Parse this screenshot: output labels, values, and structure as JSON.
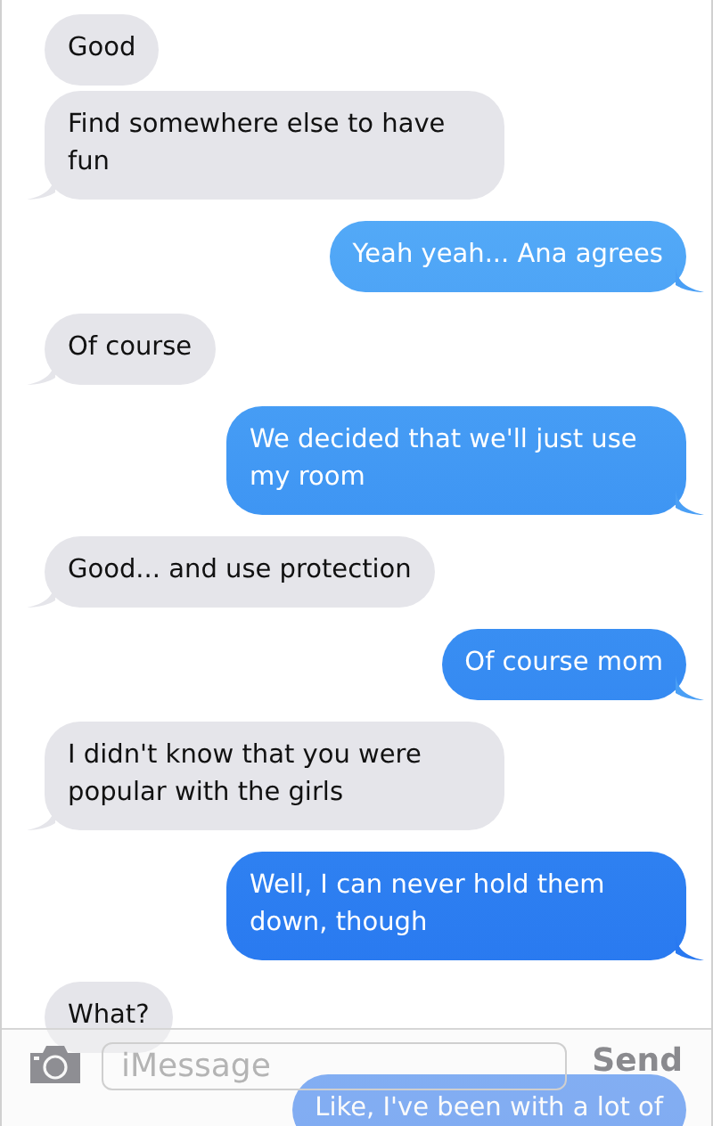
{
  "messages": [
    {
      "text": "Good",
      "kind": "received",
      "tail": false
    },
    {
      "text": "Find somewhere else to have fun",
      "kind": "received",
      "tail": true
    },
    {
      "text": "Yeah yeah... Ana agrees",
      "kind": "sent",
      "tail": true
    },
    {
      "text": "Of course",
      "kind": "received",
      "tail": true
    },
    {
      "text": "We decided that we'll just use my room",
      "kind": "sent",
      "tail": true
    },
    {
      "text": "Good... and use protection",
      "kind": "received",
      "tail": true
    },
    {
      "text": "Of course mom",
      "kind": "sent",
      "tail": true
    },
    {
      "text": "I didn't know that you were popular with the girls",
      "kind": "received",
      "tail": true
    },
    {
      "text": "Well, I can never hold them down, though",
      "kind": "sent",
      "tail": true
    },
    {
      "text": "What?",
      "kind": "received",
      "tail": false
    },
    {
      "text": "Like, I've been with a lot of",
      "kind": "sent",
      "tail": false
    }
  ],
  "composer": {
    "placeholder": "iMessage",
    "send": "Send"
  }
}
